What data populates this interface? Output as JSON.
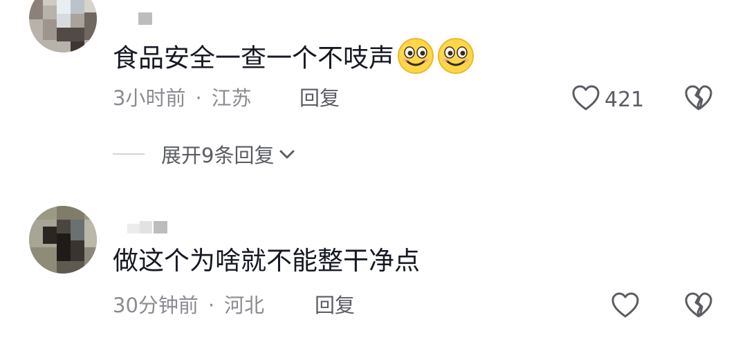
{
  "comments": [
    {
      "text": "食品安全一查一个不吱声",
      "emoji_count": 2,
      "emoji_icon": "slightly-smiling-face-icon",
      "time": "3小时前",
      "separator": "·",
      "location": "江苏",
      "reply_label": "回复",
      "like_count": "421"
    },
    {
      "text": "做这个为啥就不能整干净点",
      "time": "30分钟前",
      "separator": "·",
      "location": "河北",
      "reply_label": "回复",
      "like_count": ""
    }
  ],
  "expand_replies": {
    "label": "展开9条回复"
  },
  "colors": {
    "text_primary": "#161823",
    "text_secondary": "#8a8b91",
    "icon": "#5a5b63"
  }
}
